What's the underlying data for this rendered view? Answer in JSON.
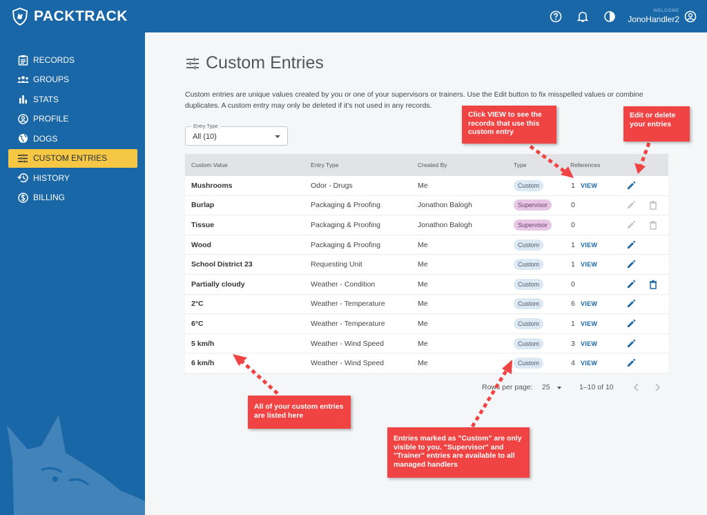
{
  "app": {
    "name": "PACKTRACK"
  },
  "header": {
    "welcome": "WELCOME",
    "username": "JonoHandler2"
  },
  "sidebar": {
    "items": [
      {
        "label": "RECORDS",
        "icon": "clipboard-icon",
        "active": false
      },
      {
        "label": "GROUPS",
        "icon": "group-icon",
        "active": false
      },
      {
        "label": "STATS",
        "icon": "bar-chart-icon",
        "active": false
      },
      {
        "label": "PROFILE",
        "icon": "account-circle-icon",
        "active": false
      },
      {
        "label": "DOGS",
        "icon": "globe-paw-icon",
        "active": false
      },
      {
        "label": "CUSTOM ENTRIES",
        "icon": "sliders-icon",
        "active": true
      },
      {
        "label": "HISTORY",
        "icon": "history-icon",
        "active": false
      },
      {
        "label": "BILLING",
        "icon": "dollar-circle-icon",
        "active": false
      }
    ]
  },
  "page": {
    "title": "Custom Entries",
    "description": "Custom entries are unique values created by you or one of your supervisors or trainers. Use the Edit button to fix misspelled values or combine duplicates. A custom entry may only be deleted if it's not used in any records."
  },
  "filter": {
    "label": "Entry Type",
    "value": "All (10)"
  },
  "table": {
    "headers": [
      "Custom Value",
      "Entry Type",
      "Created By",
      "Type",
      "References"
    ],
    "rows": [
      {
        "value": "Mushrooms",
        "entry_type": "Odor - Drugs",
        "created_by": "Me",
        "type": "Custom",
        "refs": "1",
        "view": "VIEW",
        "edit": true,
        "delete": false
      },
      {
        "value": "Burlap",
        "entry_type": "Packaging & Proofing",
        "created_by": "Jonathon Balogh",
        "type": "Supervisor",
        "refs": "0",
        "view": "",
        "edit": "disabled",
        "delete": "disabled"
      },
      {
        "value": "Tissue",
        "entry_type": "Packaging & Proofing",
        "created_by": "Jonathon Balogh",
        "type": "Supervisor",
        "refs": "0",
        "view": "",
        "edit": "disabled",
        "delete": "disabled"
      },
      {
        "value": "Wood",
        "entry_type": "Packaging & Proofing",
        "created_by": "Me",
        "type": "Custom",
        "refs": "1",
        "view": "VIEW",
        "edit": true,
        "delete": false
      },
      {
        "value": "School District 23",
        "entry_type": "Requesting Unit",
        "created_by": "Me",
        "type": "Custom",
        "refs": "1",
        "view": "VIEW",
        "edit": true,
        "delete": false
      },
      {
        "value": "Partially cloudy",
        "entry_type": "Weather - Condition",
        "created_by": "Me",
        "type": "Custom",
        "refs": "0",
        "view": "",
        "edit": true,
        "delete": true
      },
      {
        "value": "2°C",
        "entry_type": "Weather - Temperature",
        "created_by": "Me",
        "type": "Custom",
        "refs": "6",
        "view": "VIEW",
        "edit": true,
        "delete": false
      },
      {
        "value": "6°C",
        "entry_type": "Weather - Temperature",
        "created_by": "Me",
        "type": "Custom",
        "refs": "1",
        "view": "VIEW",
        "edit": true,
        "delete": false
      },
      {
        "value": "5 km/h",
        "entry_type": "Weather - Wind Speed",
        "created_by": "Me",
        "type": "Custom",
        "refs": "3",
        "view": "VIEW",
        "edit": true,
        "delete": false
      },
      {
        "value": "6 km/h",
        "entry_type": "Weather - Wind Speed",
        "created_by": "Me",
        "type": "Custom",
        "refs": "4",
        "view": "VIEW",
        "edit": true,
        "delete": false
      }
    ]
  },
  "pagination": {
    "rows_per_page_label": "Rows per page:",
    "rows_per_page": "25",
    "range": "1–10 of 10"
  },
  "callouts": {
    "view": "Click VIEW to see the records that use this custom entry",
    "edit": "Edit or delete your entries",
    "list": "All of your custom entries are listed here",
    "types": "Entries marked as \"Custom\" are only visible to you. \"Supervisor\" and \"Trainer\" entries are available to all managed handlers"
  },
  "colors": {
    "brand": "#1a67a8",
    "active_nav": "#f5c744",
    "callout": "#f04343",
    "chip_custom": "#dbe9f4",
    "chip_supervisor": "#e8c7e6"
  }
}
